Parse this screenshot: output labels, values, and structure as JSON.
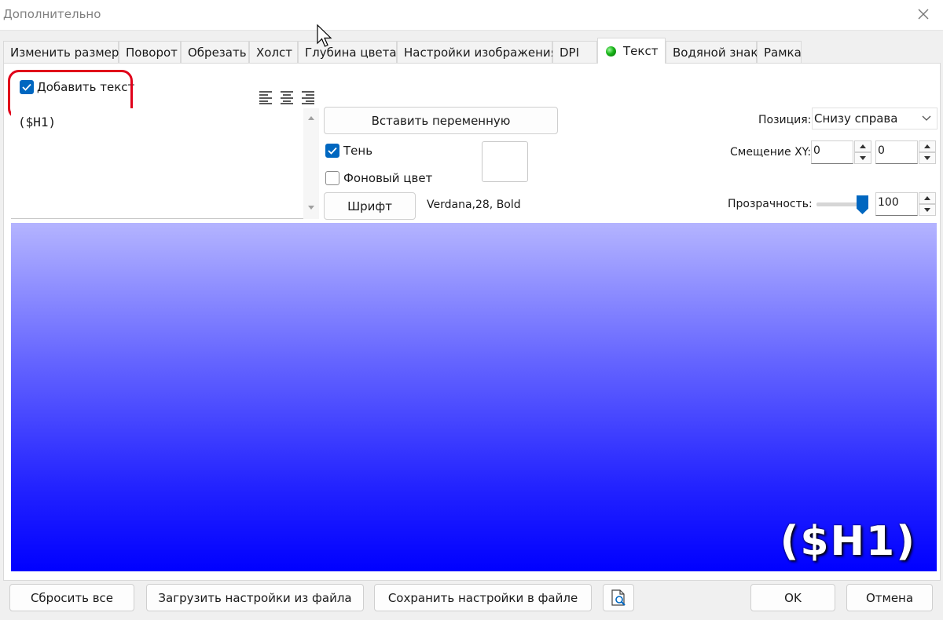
{
  "window": {
    "title": "Дополнительно"
  },
  "tabs": [
    {
      "label": "Изменить размер"
    },
    {
      "label": "Поворот"
    },
    {
      "label": "Обрезать"
    },
    {
      "label": "Холст"
    },
    {
      "label": "Глубина цвета"
    },
    {
      "label": "Настройки изображения"
    },
    {
      "label": "DPI"
    },
    {
      "label": "Текст",
      "active": true,
      "status_color": "#17b317"
    },
    {
      "label": "Водяной знак"
    },
    {
      "label": "Рамка"
    }
  ],
  "text_tab": {
    "add_text": {
      "label": "Добавить текст",
      "checked": true
    },
    "text_value": "($H1)",
    "insert_variable_label": "Вставить переменную",
    "shadow": {
      "label": "Тень",
      "checked": true
    },
    "bg_color": {
      "label": "Фоновый цвет",
      "checked": false
    },
    "font_button_label": "Шрифт",
    "font_value": "Verdana,28, Bold",
    "position": {
      "label": "Позиция:",
      "value": "Снизу справа"
    },
    "offset": {
      "label": "Смещение XY:",
      "x": "0",
      "y": "0"
    },
    "opacity": {
      "label": "Прозрачность:",
      "value": "100",
      "level_percent": 100
    },
    "preview_text": "($H1)"
  },
  "footer": {
    "reset_all": "Сбросить все",
    "load_settings": "Загрузить настройки из файла",
    "save_settings": "Сохранить настройки в файле",
    "ok": "OK",
    "cancel": "Отмена"
  },
  "colors": {
    "accent": "#0067c0",
    "highlight": "#e0001a",
    "preview_top": "#b4b4ff",
    "preview_bottom": "#0000ff"
  }
}
